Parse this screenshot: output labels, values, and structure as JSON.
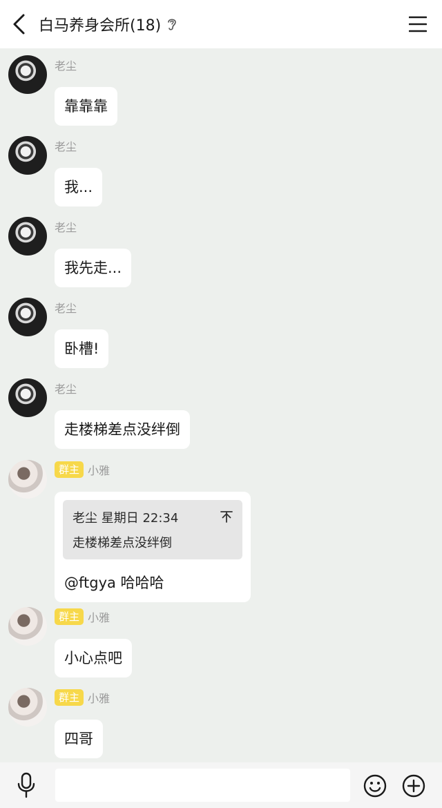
{
  "header": {
    "title": "白马养身会所(18)",
    "back_icon": "chevron-left-icon",
    "ear_icon": "ear-icon",
    "menu_icon": "hamburger-menu-icon"
  },
  "messages": [
    {
      "sender": "老尘",
      "text": "靠靠靠"
    },
    {
      "sender": "老尘",
      "text": "我..."
    },
    {
      "sender": "老尘",
      "text": "我先走..."
    },
    {
      "sender": "老尘",
      "text": "卧槽!"
    },
    {
      "sender": "老尘",
      "text": "走楼梯差点没绊倒"
    },
    {
      "badge": "群主",
      "sender": "小雅",
      "quote": {
        "author": "老尘",
        "time": "星期日 22:34",
        "text": "走楼梯差点没绊倒"
      },
      "text": "@ftgya 哈哈哈"
    },
    {
      "badge": "群主",
      "sender": "小雅",
      "text": "小心点吧"
    },
    {
      "badge": "群主",
      "sender": "小雅",
      "text": "四哥"
    }
  ],
  "composer": {
    "value": "",
    "voice_icon": "microphone-icon",
    "emoji_icon": "smiley-icon",
    "plus_icon": "plus-circle-icon"
  },
  "colors": {
    "background": "#edf0ed",
    "bubble": "#ffffff",
    "badge": "#f7d84a",
    "name": "#9a9a9a"
  }
}
